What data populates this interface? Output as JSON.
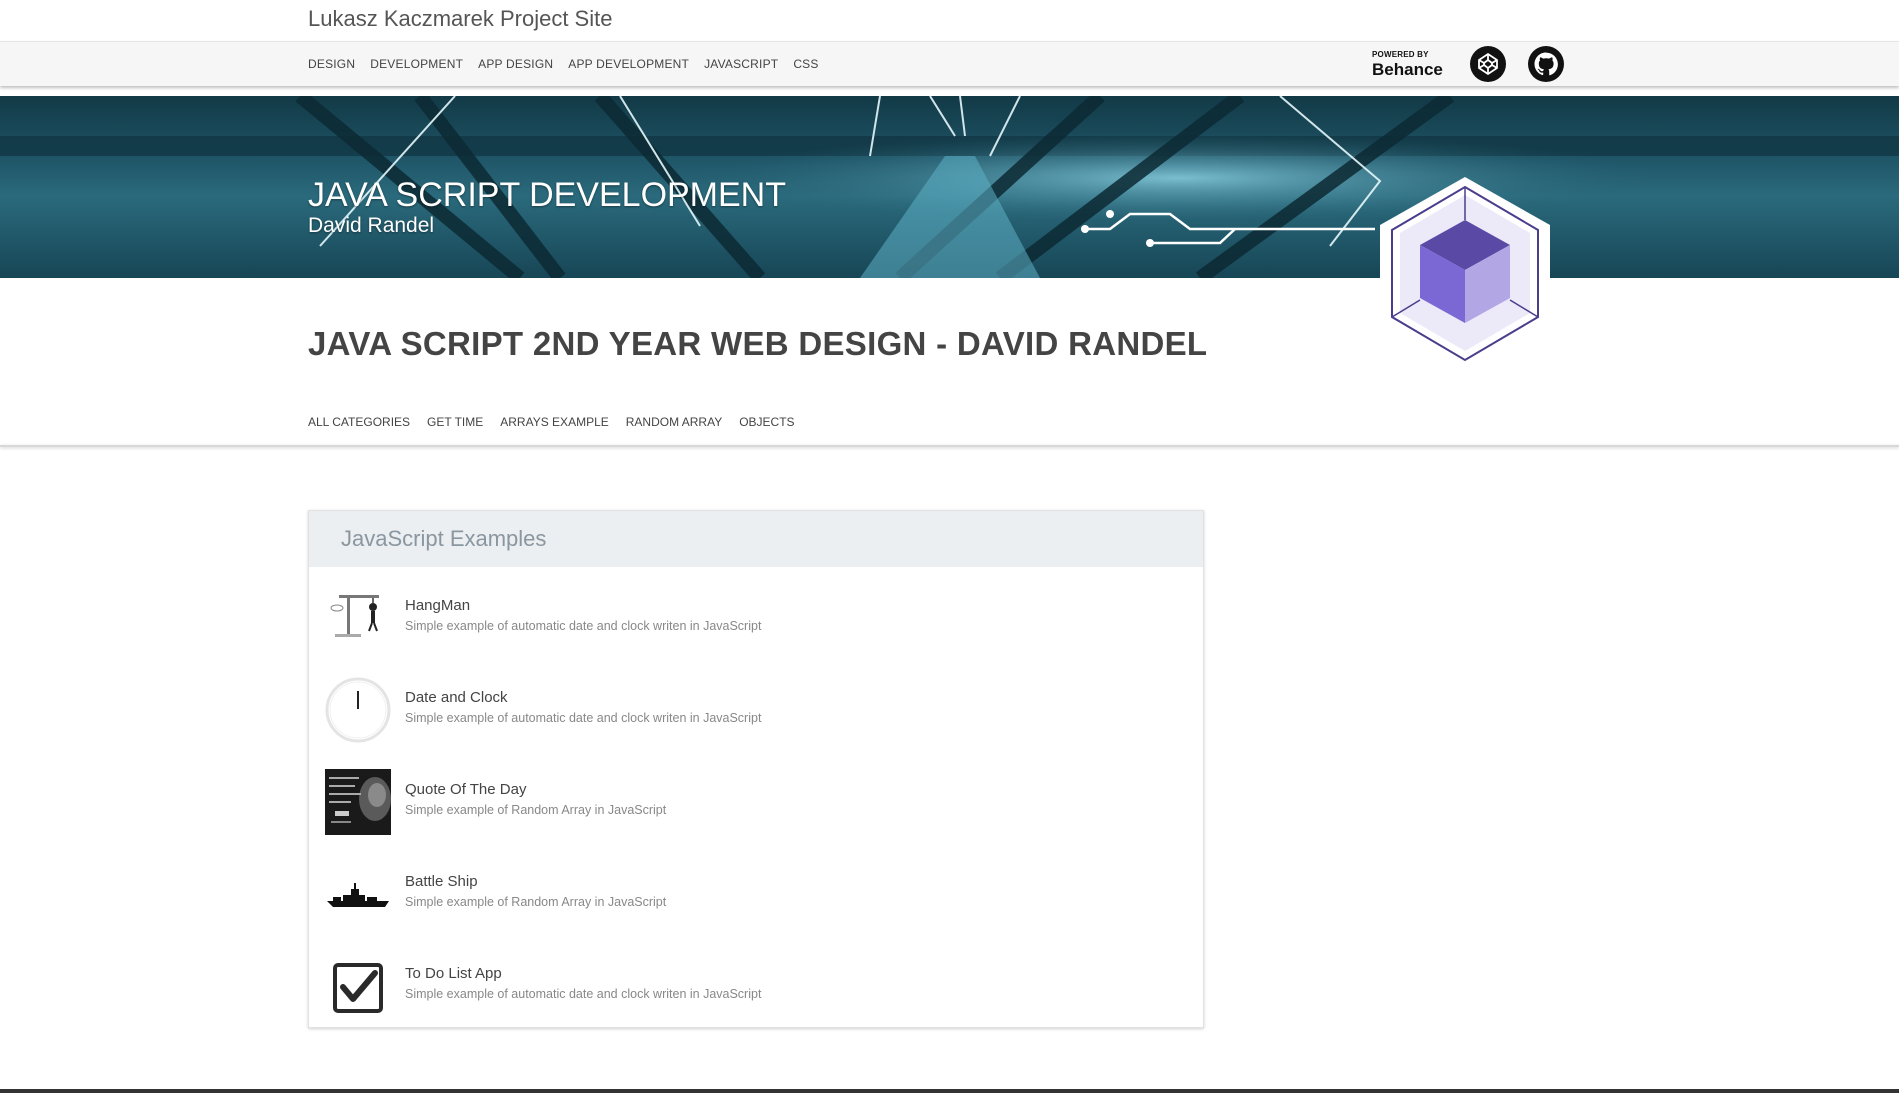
{
  "site_title": "Lukasz Kaczmarek Project Site",
  "topnav": {
    "items": [
      "DESIGN",
      "DEVELOPMENT",
      "APP DESIGN",
      "APP DEVELOPMENT",
      "JAVASCRIPT",
      "CSS"
    ],
    "behance_powered": "POWERED BY",
    "behance_name": "Behance",
    "icons": [
      "behance-logo",
      "codepen-icon",
      "github-icon"
    ]
  },
  "hero": {
    "title": "JAVA SCRIPT DEVELOPMENT",
    "subtitle": "David Randel"
  },
  "page_heading": "JAVA SCRIPT 2ND YEAR WEB DESIGN - DAVID RANDEL",
  "subnav": {
    "items": [
      "ALL CATEGORIES",
      "GET TIME",
      "ARRAYS EXAMPLE",
      "RANDOM ARRAY",
      "OBJECTS"
    ]
  },
  "card": {
    "title": "JavaScript Examples",
    "items": [
      {
        "title": "HangMan",
        "desc": "Simple example of automatic date and clock writen in JavaScript",
        "icon": "hangman-thumbnail"
      },
      {
        "title": "Date and Clock",
        "desc": "Simple example of automatic date and clock writen in JavaScript",
        "icon": "clock-thumbnail"
      },
      {
        "title": "Quote Of The Day",
        "desc": "Simple example of Random Array in JavaScript",
        "icon": "quote-thumbnail"
      },
      {
        "title": "Battle Ship",
        "desc": "Simple example of Random Array in JavaScript",
        "icon": "battleship-thumbnail"
      },
      {
        "title": "To Do List App",
        "desc": "Simple example of automatic date and clock writen in JavaScript",
        "icon": "checkbox-thumbnail"
      }
    ]
  },
  "colors": {
    "hero_bg": "#1d4a5a",
    "card_header_bg": "#eceff1",
    "hex_purple": "#7b68d4"
  }
}
